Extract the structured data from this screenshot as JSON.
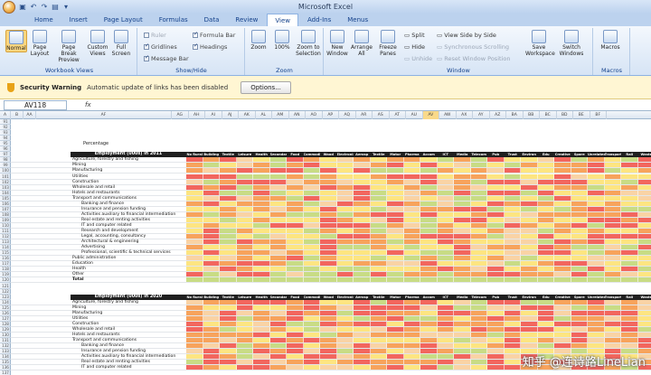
{
  "app_title": "Microsoft Excel",
  "tabs": [
    "Home",
    "Insert",
    "Page Layout",
    "Formulas",
    "Data",
    "Review",
    "View",
    "Add-Ins",
    "Menus"
  ],
  "active_tab": "View",
  "ribbon": {
    "workbook_views": {
      "label": "Workbook Views",
      "items": [
        "Normal",
        "Page Layout",
        "Page Break Preview",
        "Custom Views",
        "Full Screen"
      ]
    },
    "show_hide": {
      "label": "Show/Hide",
      "checks": [
        {
          "label": "Ruler",
          "on": false,
          "dim": true
        },
        {
          "label": "Formula Bar",
          "on": true,
          "dim": false
        },
        {
          "label": "Gridlines",
          "on": true,
          "dim": false
        },
        {
          "label": "Headings",
          "on": true,
          "dim": false
        },
        {
          "label": "Message Bar",
          "on": true,
          "dim": false
        }
      ]
    },
    "zoom": {
      "label": "Zoom",
      "items": [
        "Zoom",
        "100%",
        "Zoom to Selection"
      ]
    },
    "window": {
      "label": "Window",
      "items": [
        "New Window",
        "Arrange All",
        "Freeze Panes"
      ],
      "small": [
        {
          "label": "Split",
          "dim": false
        },
        {
          "label": "Hide",
          "dim": false
        },
        {
          "label": "Unhide",
          "dim": true
        },
        {
          "label": "View Side by Side",
          "dim": false
        },
        {
          "label": "Synchronous Scrolling",
          "dim": true
        },
        {
          "label": "Reset Window Position",
          "dim": true
        }
      ],
      "extra": [
        "Save Workspace",
        "Switch Windows"
      ]
    },
    "macros": {
      "label": "Macros",
      "items": [
        "Macros"
      ]
    }
  },
  "security": {
    "title": "Security Warning",
    "message": "Automatic update of links has been disabled",
    "button": "Options..."
  },
  "name_box": "AV118",
  "fx": "fx",
  "col_headers": [
    "A",
    "B",
    "AA",
    "AF",
    "AG",
    "AH",
    "AI",
    "AJ",
    "AK",
    "AL",
    "AM",
    "AN",
    "AO",
    "AP",
    "AQ",
    "AR",
    "AS",
    "AT",
    "AU",
    "AV",
    "AW",
    "AX",
    "AY",
    "AZ",
    "BA",
    "BB",
    "BC",
    "BD",
    "BE",
    "BF"
  ],
  "active_col": "AV",
  "percentage_label": "Percentage",
  "table1_header": "Employment (000s) in 2011",
  "table2_header": "Employment (000s) in 2020",
  "sector_cols": [
    "No Rural",
    "Building",
    "Textile",
    "Leisure",
    "Health",
    "Secondary",
    "Food",
    "Commodity",
    "Wood",
    "Electronics",
    "Aerosp",
    "Textile",
    "Motor",
    "Pharma",
    "Accom",
    "ICT",
    "Media",
    "Telecom",
    "Pub",
    "Trust",
    "Environ",
    "Edu",
    "Creative",
    "Spare",
    "Unrelated",
    "Transport",
    "Rail",
    "Waste",
    "Dig"
  ],
  "rows1": [
    "Agriculture, forestry and fishing",
    "Mining",
    "Manufacturing",
    "Utilities",
    "Construction",
    "Wholesale and retail",
    "Hotels and restaurants",
    "Transport and communications",
    "Banking and finance",
    "Insurance and pension funding",
    "Activities auxiliary to financial intermediation",
    "Real estate and renting activities",
    "IT and computer related",
    "Research and development",
    "Legal, accounting, consultancy",
    "Architectural & engineering",
    "Advertising",
    "Professional, scientific & technical services",
    "Public administration",
    "Education",
    "Health",
    "Other",
    "Total"
  ],
  "rows2": [
    "Agriculture, forestry and fishing",
    "Mining",
    "Manufacturing",
    "Utilities",
    "Construction",
    "Wholesale and retail",
    "Hotels and restaurants",
    "Transport and communications",
    "Banking and finance",
    "Insurance and pension funding",
    "Activities auxiliary to financial intermediation",
    "Real estate and renting activities",
    "IT and computer related"
  ],
  "indented1": [
    8,
    9,
    10,
    11,
    12,
    13,
    14,
    15,
    16,
    17
  ],
  "indented2": [
    8,
    9,
    10,
    11,
    12
  ],
  "row_numbers_start": 91,
  "watermark": "知乎 @连诗路LineLian",
  "colors": {
    "red": "#f2665e",
    "orange": "#f7a35c",
    "yellow": "#fde581",
    "green": "#c8dc85",
    "pale": "#f9d3a5"
  }
}
